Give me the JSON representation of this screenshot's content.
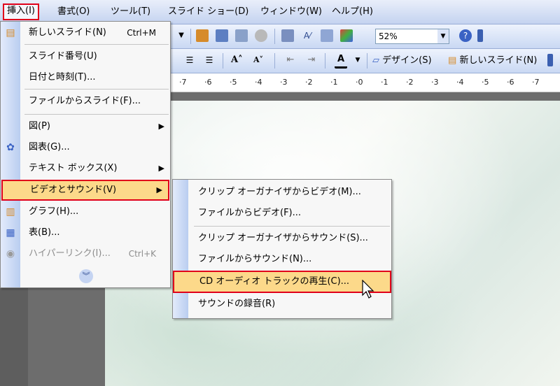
{
  "menubar": {
    "items": [
      "挿入(I)",
      "書式(O)",
      "ツール(T)",
      "スライド ショー(D)",
      "ウィンドウ(W)",
      "ヘルプ(H)"
    ]
  },
  "toolbar": {
    "zoom": "52%",
    "design_label": "デザイン(S)",
    "new_slide_label": "新しいスライド(N)"
  },
  "ruler": {
    "ticks": [
      "·7",
      "·6",
      "·5",
      "·4",
      "·3",
      "·2",
      "·1",
      "·0",
      "·1",
      "·2",
      "·3",
      "·4",
      "·5",
      "·6",
      "·7"
    ]
  },
  "insert_menu": {
    "new_slide": {
      "label": "新しいスライド(N)",
      "shortcut": "Ctrl+M"
    },
    "slide_number": "スライド番号(U)",
    "date_time": "日付と時刻(T)...",
    "slides_from_file": "ファイルからスライド(F)...",
    "picture": "図(P)",
    "diagram": "図表(G)...",
    "text_box": "テキスト ボックス(X)",
    "movies_sounds": "ビデオとサウンド(V)",
    "chart": "グラフ(H)...",
    "table": "表(B)...",
    "hyperlink": {
      "label": "ハイパーリンク(I)...",
      "shortcut": "Ctrl+K"
    }
  },
  "sub_menu": {
    "movie_organizer": "クリップ オーガナイザからビデオ(M)...",
    "movie_file": "ファイルからビデオ(F)...",
    "sound_organizer": "クリップ オーガナイザからサウンド(S)...",
    "sound_file": "ファイルからサウンド(N)...",
    "cd_audio": "CD オーディオ トラックの再生(C)...",
    "record_sound": "サウンドの録音(R)"
  },
  "colors": {
    "highlight": "#fcd98a",
    "red_outline": "#e0001a",
    "menubar": "#c4d3f0"
  }
}
